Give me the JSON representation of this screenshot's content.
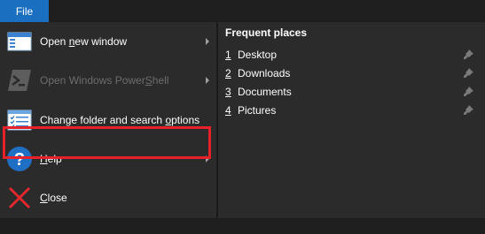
{
  "tab": {
    "label": "File"
  },
  "menu": {
    "items": [
      {
        "pre": "Open ",
        "key": "n",
        "post": "ew window",
        "has_arrow": true,
        "disabled": false,
        "icon": "window-icon"
      },
      {
        "pre": "Open Windows Power",
        "key": "S",
        "post": "hell",
        "has_arrow": true,
        "disabled": true,
        "icon": "powershell-icon"
      },
      {
        "pre": "Change folder and search ",
        "key": "o",
        "post": "ptions",
        "has_arrow": false,
        "disabled": false,
        "icon": "folder-options-icon"
      },
      {
        "pre": "",
        "key": "H",
        "post": "elp",
        "has_arrow": true,
        "disabled": false,
        "icon": "help-icon"
      },
      {
        "pre": "",
        "key": "C",
        "post": "lose",
        "has_arrow": false,
        "disabled": false,
        "icon": "close-icon"
      }
    ],
    "highlighted_item": 2,
    "highlight_color": "#e8202a"
  },
  "places": {
    "title": "Frequent places",
    "items": [
      {
        "num": "1",
        "name": "Desktop"
      },
      {
        "num": "2",
        "name": "Downloads"
      },
      {
        "num": "3",
        "name": "Documents"
      },
      {
        "num": "4",
        "name": "Pictures"
      }
    ]
  },
  "colors": {
    "accent": "#1a6fc0",
    "panel": "#2b2b2b",
    "background": "#1f1f1f"
  }
}
